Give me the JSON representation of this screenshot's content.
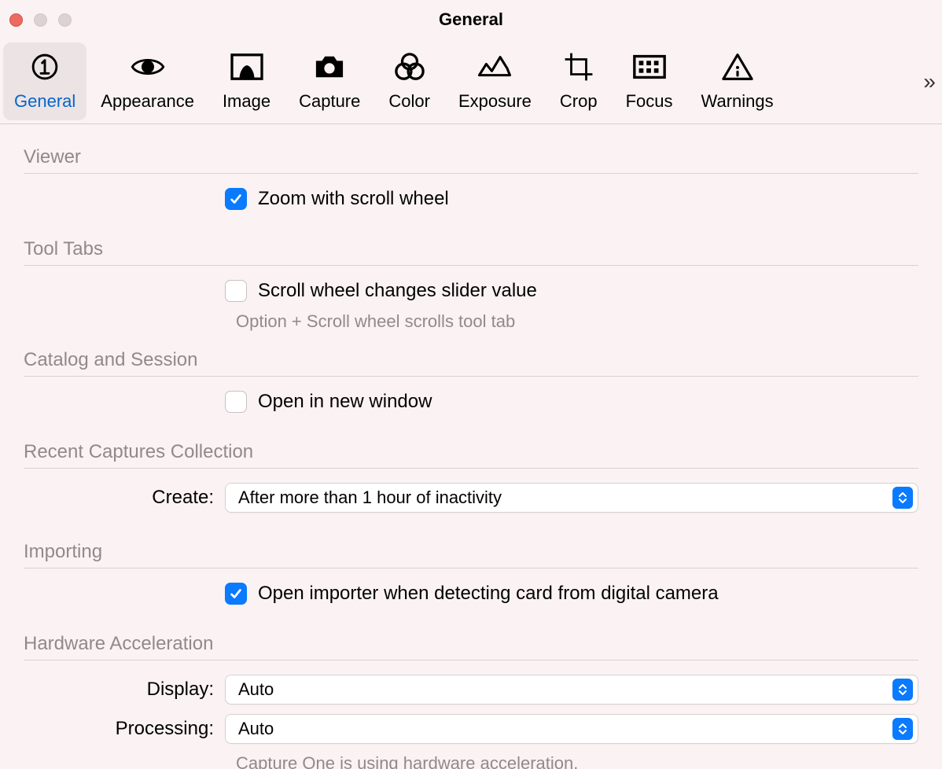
{
  "window": {
    "title": "General"
  },
  "toolbar": {
    "items": [
      {
        "key": "general",
        "label": "General"
      },
      {
        "key": "appearance",
        "label": "Appearance"
      },
      {
        "key": "image",
        "label": "Image"
      },
      {
        "key": "capture",
        "label": "Capture"
      },
      {
        "key": "color",
        "label": "Color"
      },
      {
        "key": "exposure",
        "label": "Exposure"
      },
      {
        "key": "crop",
        "label": "Crop"
      },
      {
        "key": "focus",
        "label": "Focus"
      },
      {
        "key": "warnings",
        "label": "Warnings"
      }
    ]
  },
  "sections": {
    "viewer": {
      "title": "Viewer",
      "zoom_scroll_label": "Zoom with scroll wheel",
      "zoom_scroll_checked": true
    },
    "tool_tabs": {
      "title": "Tool Tabs",
      "scroll_slider_label": "Scroll wheel changes slider value",
      "scroll_slider_checked": false,
      "hint": "Option + Scroll wheel scrolls tool tab"
    },
    "catalog_session": {
      "title": "Catalog and Session",
      "open_new_window_label": "Open in new window",
      "open_new_window_checked": false
    },
    "recent_captures": {
      "title": "Recent Captures Collection",
      "create_label": "Create:",
      "create_value": "After more than 1 hour of inactivity"
    },
    "importing": {
      "title": "Importing",
      "open_importer_label": "Open importer when detecting card from digital camera",
      "open_importer_checked": true
    },
    "hw_accel": {
      "title": "Hardware Acceleration",
      "display_label": "Display:",
      "display_value": "Auto",
      "processing_label": "Processing:",
      "processing_value": "Auto",
      "status": "Capture One is using hardware acceleration."
    }
  }
}
